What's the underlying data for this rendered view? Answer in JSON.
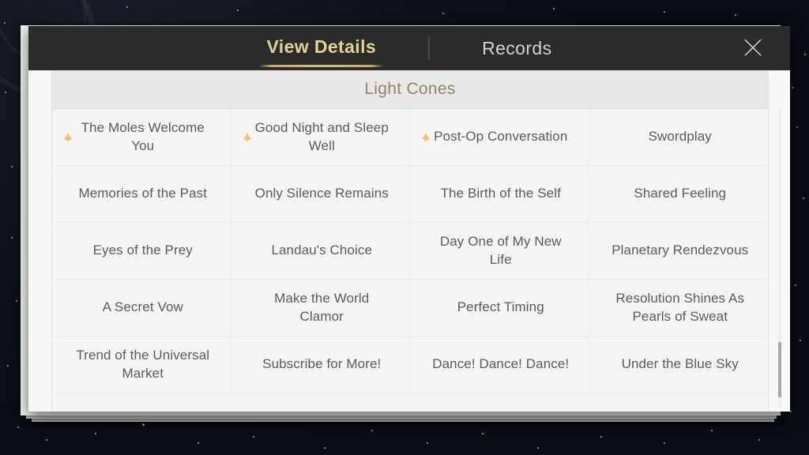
{
  "window": {
    "tabs": [
      {
        "label": "View Details",
        "active": true
      },
      {
        "label": "Records",
        "active": false
      }
    ],
    "close_icon": "close-x-icon",
    "accent_color": "#c8a967",
    "active_tab_color": "#e4cf9c",
    "inactive_tab_color": "#d2d2cf",
    "titlebar_color": "#2b2b29"
  },
  "section": {
    "title": "Light Cones",
    "title_color": "#93846a",
    "header_bg": "#e8e8e6"
  },
  "table": {
    "columns": 4,
    "text_color": "#5b5b5b",
    "marker_color": "#f4b95a",
    "marker_icon": "new-item-marker-icon",
    "rows": [
      [
        {
          "name": "The Moles Welcome You",
          "marker": true
        },
        {
          "name": "Good Night and Sleep Well",
          "marker": true
        },
        {
          "name": "Post-Op Conversation",
          "marker": true
        },
        {
          "name": "Swordplay",
          "marker": false
        }
      ],
      [
        {
          "name": "Memories of the Past",
          "marker": false
        },
        {
          "name": "Only Silence Remains",
          "marker": false
        },
        {
          "name": "The Birth of the Self",
          "marker": false
        },
        {
          "name": "Shared Feeling",
          "marker": false
        }
      ],
      [
        {
          "name": "Eyes of the Prey",
          "marker": false
        },
        {
          "name": "Landau's Choice",
          "marker": false
        },
        {
          "name": "Day One of My New Life",
          "marker": false
        },
        {
          "name": "Planetary Rendezvous",
          "marker": false
        }
      ],
      [
        {
          "name": "A Secret Vow",
          "marker": false
        },
        {
          "name": "Make the World Clamor",
          "marker": false
        },
        {
          "name": "Perfect Timing",
          "marker": false
        },
        {
          "name": "Resolution Shines As Pearls of Sweat",
          "marker": false
        }
      ],
      [
        {
          "name": "Trend of the Universal Market",
          "marker": false
        },
        {
          "name": "Subscribe for More!",
          "marker": false
        },
        {
          "name": "Dance! Dance! Dance!",
          "marker": false
        },
        {
          "name": "Under the Blue Sky",
          "marker": false
        }
      ]
    ]
  },
  "scrollbar": {
    "orientation": "vertical",
    "thumb_color": "#a9a9a7",
    "track_color": "#ededec"
  }
}
